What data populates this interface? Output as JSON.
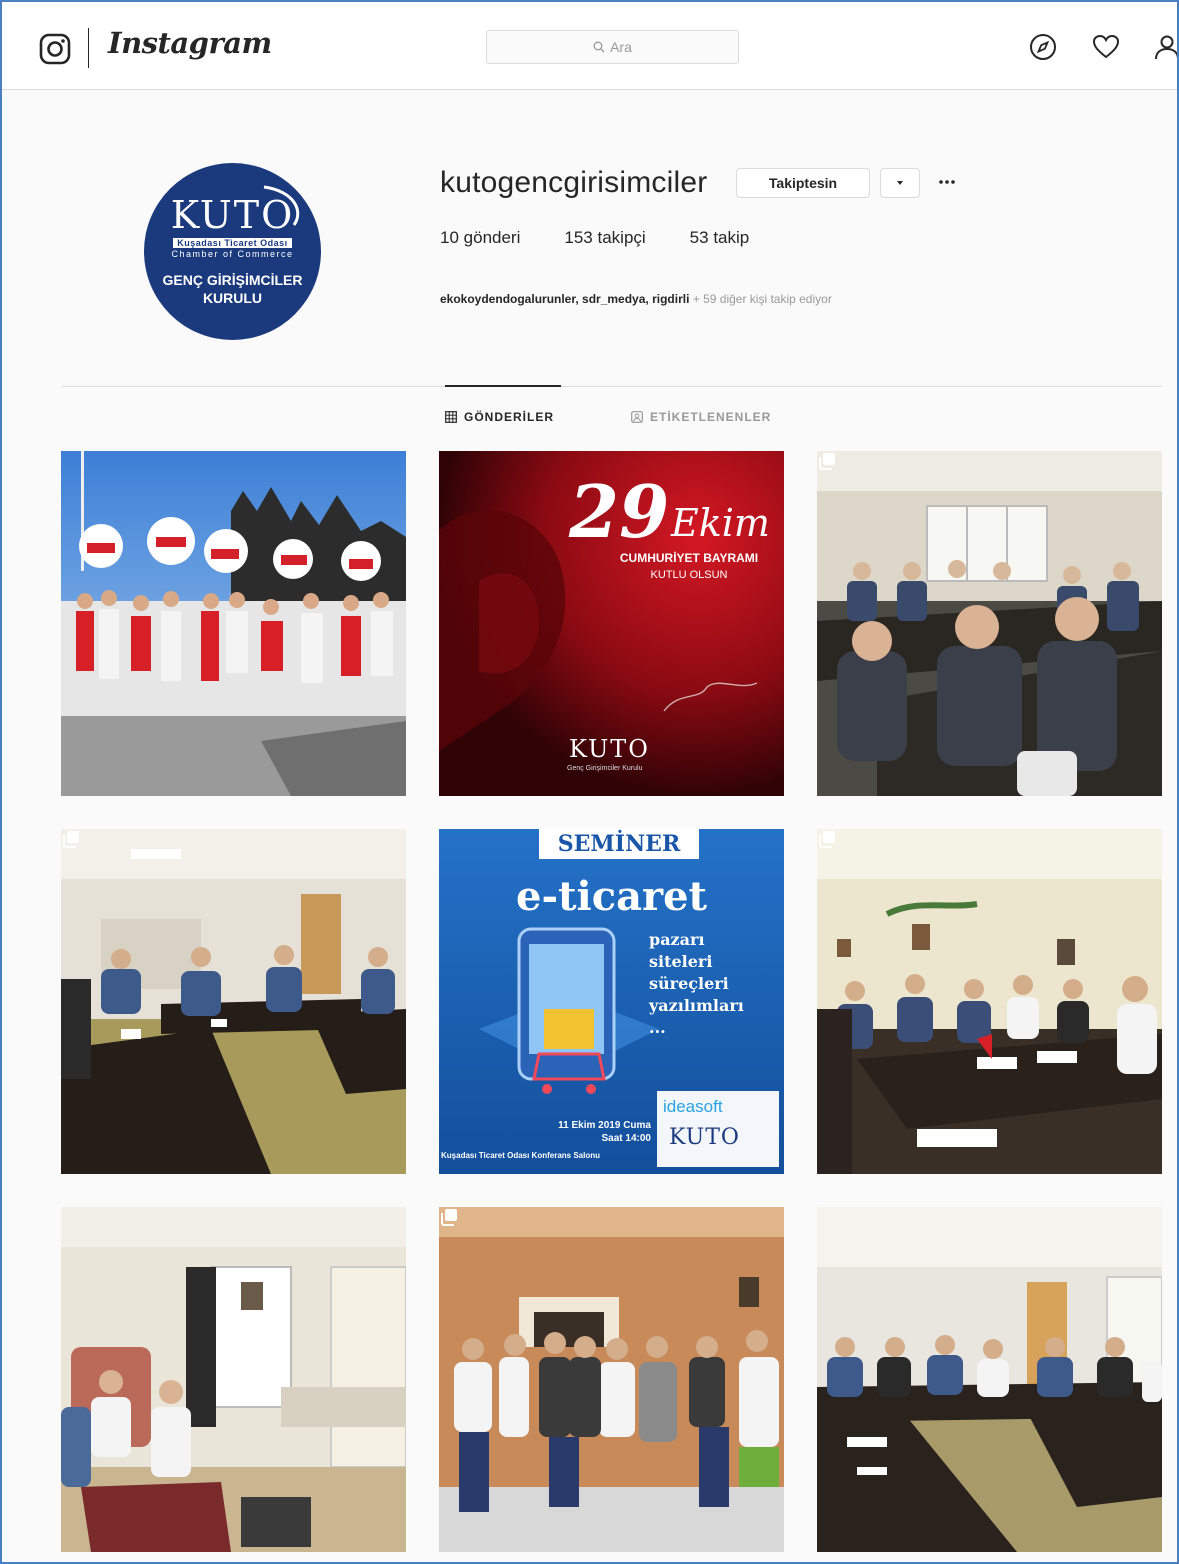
{
  "header": {
    "wordmark": "Instagram",
    "search_placeholder": "Ara",
    "icons": [
      "instagram-glyph-icon",
      "compass-icon",
      "heart-icon",
      "user-icon"
    ]
  },
  "profile": {
    "username": "kutogencgirisimciler",
    "follow_label": "Takiptesin",
    "stats": [
      {
        "value": "10",
        "label": "gönderi"
      },
      {
        "value": "153",
        "label": "takipçi"
      },
      {
        "value": "53",
        "label": "takip"
      }
    ],
    "followed_by_names": "ekokoydendogalurunler, sdr_medya, rigdirli",
    "followed_by_more": " + 59 diğer kişi takip ediyor",
    "avatar": {
      "word": "KUTO",
      "line1": "Kuşadası Ticaret Odası",
      "line2": "Chamber of Commerce",
      "line3a": "GENÇ GİRİŞİMCİLER",
      "line3b": "KURULU"
    }
  },
  "tabs": [
    {
      "label": "GÖNDERİLER",
      "active": true
    },
    {
      "label": "ETİKETLENENLER",
      "active": false
    }
  ],
  "posts": [
    {
      "kind": "photo-monument",
      "multi": false
    },
    {
      "kind": "graphic-29-ekim",
      "multi": false,
      "big_number": "29",
      "word": "Ekim",
      "line1": "CUMHURİYET BAYRAMI",
      "line2": "KUTLU OLSUN",
      "logo": "KUTO",
      "footer": "Genç Girişimciler Kurulu"
    },
    {
      "kind": "photo-meeting",
      "multi": true
    },
    {
      "kind": "photo-meeting",
      "multi": true
    },
    {
      "kind": "graphic-seminer",
      "multi": false,
      "badge": "SEMİNER",
      "title": "e-ticaret",
      "items": [
        "pazarı",
        "siteleri",
        "süreçleri",
        "yazılımları",
        "..."
      ],
      "date": "11 Ekim 2019 Cuma",
      "time": "Saat 14:00",
      "venue": "Kuşadası Ticaret Odası Konferans Salonu",
      "sponsor": "ideasoft",
      "logo": "KUTO"
    },
    {
      "kind": "photo-meeting",
      "multi": true
    },
    {
      "kind": "photo-office",
      "multi": false
    },
    {
      "kind": "photo-group",
      "multi": true
    },
    {
      "kind": "photo-meeting",
      "multi": false
    }
  ],
  "colors": {
    "text": "#262626",
    "muted": "#999999",
    "border": "#dbdbdb",
    "kuto_blue": "#1b3a7e",
    "seminer_blue": "#1f5fb0",
    "bayram_red": "#b0101c"
  }
}
